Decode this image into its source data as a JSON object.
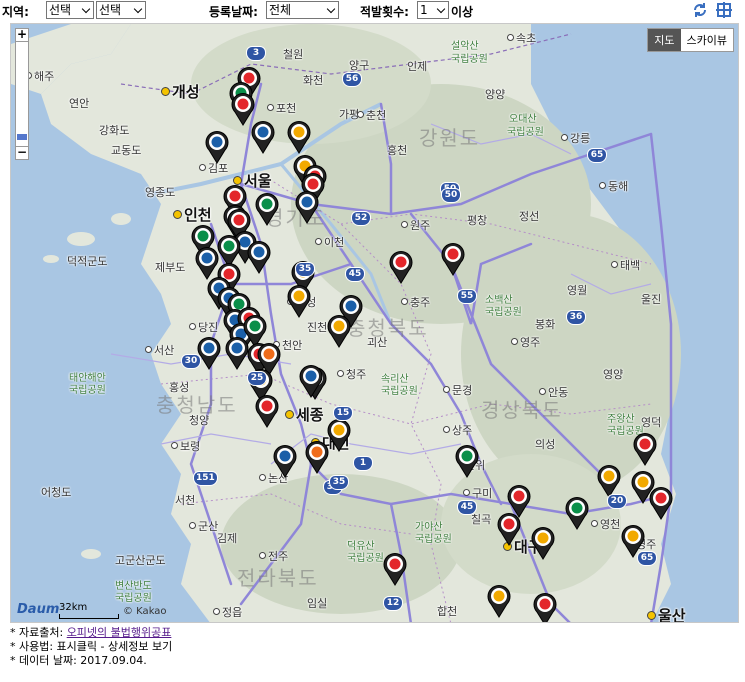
{
  "filters": {
    "region_label": "지역:",
    "region_value1": "선택",
    "region_value2": "선택",
    "date_label": "등록날짜:",
    "date_value": "전체",
    "count_label": "적발횟수:",
    "count_value": "1",
    "count_suffix": "이상",
    "refresh_icon": "refresh-icon",
    "fullscreen_icon": "crosshair-icon"
  },
  "map": {
    "type_buttons": [
      "지도",
      "스카이뷰"
    ],
    "zoom_in": "+",
    "zoom_out": "−",
    "logo": "Daum",
    "scale": "32km",
    "copyright": "© Kakao",
    "places": [
      {
        "name": "해주",
        "kind": "town"
      },
      {
        "name": "개성",
        "kind": "city"
      },
      {
        "name": "연안",
        "kind": "small"
      },
      {
        "name": "철원",
        "kind": "small"
      },
      {
        "name": "설악산",
        "kind": "park"
      },
      {
        "name": "국립공원",
        "kind": "park"
      },
      {
        "name": "속초",
        "kind": "town"
      },
      {
        "name": "양구",
        "kind": "small"
      },
      {
        "name": "화천",
        "kind": "small"
      },
      {
        "name": "인제",
        "kind": "small"
      },
      {
        "name": "양양",
        "kind": "small"
      },
      {
        "name": "포천",
        "kind": "town"
      },
      {
        "name": "가평",
        "kind": "small"
      },
      {
        "name": "춘천",
        "kind": "town"
      },
      {
        "name": "홍천",
        "kind": "small"
      },
      {
        "name": "오대산",
        "kind": "park"
      },
      {
        "name": "국립공원",
        "kind": "park"
      },
      {
        "name": "강원도",
        "kind": "prov"
      },
      {
        "name": "강릉",
        "kind": "town"
      },
      {
        "name": "강화도",
        "kind": "small"
      },
      {
        "name": "교동도",
        "kind": "small"
      },
      {
        "name": "김포",
        "kind": "town"
      },
      {
        "name": "서울",
        "kind": "city"
      },
      {
        "name": "영종도",
        "kind": "small"
      },
      {
        "name": "인천",
        "kind": "city"
      },
      {
        "name": "동해",
        "kind": "town"
      },
      {
        "name": "평창",
        "kind": "small"
      },
      {
        "name": "정선",
        "kind": "small"
      },
      {
        "name": "원주",
        "kind": "town"
      },
      {
        "name": "경기도",
        "kind": "prov"
      },
      {
        "name": "이천",
        "kind": "town"
      },
      {
        "name": "덕적군도",
        "kind": "small"
      },
      {
        "name": "제부도",
        "kind": "small"
      },
      {
        "name": "태백",
        "kind": "town"
      },
      {
        "name": "영월",
        "kind": "small"
      },
      {
        "name": "충주",
        "kind": "town"
      },
      {
        "name": "안성",
        "kind": "town"
      },
      {
        "name": "소백산",
        "kind": "park"
      },
      {
        "name": "국립공원",
        "kind": "park"
      },
      {
        "name": "울진",
        "kind": "small"
      },
      {
        "name": "당진",
        "kind": "town"
      },
      {
        "name": "진천",
        "kind": "small"
      },
      {
        "name": "충청북도",
        "kind": "prov"
      },
      {
        "name": "봉화",
        "kind": "small"
      },
      {
        "name": "서산",
        "kind": "town"
      },
      {
        "name": "괴산",
        "kind": "small"
      },
      {
        "name": "영주",
        "kind": "town"
      },
      {
        "name": "태안해안",
        "kind": "park"
      },
      {
        "name": "국립공원",
        "kind": "park"
      },
      {
        "name": "천안",
        "kind": "town"
      },
      {
        "name": "청주",
        "kind": "town"
      },
      {
        "name": "속리산",
        "kind": "park"
      },
      {
        "name": "국립공원",
        "kind": "park"
      },
      {
        "name": "문경",
        "kind": "town"
      },
      {
        "name": "안동",
        "kind": "town"
      },
      {
        "name": "영양",
        "kind": "small"
      },
      {
        "name": "홍성",
        "kind": "small"
      },
      {
        "name": "충청남도",
        "kind": "prov"
      },
      {
        "name": "세종",
        "kind": "city"
      },
      {
        "name": "경상북도",
        "kind": "prov"
      },
      {
        "name": "청양",
        "kind": "small"
      },
      {
        "name": "대전",
        "kind": "city"
      },
      {
        "name": "주왕산",
        "kind": "park"
      },
      {
        "name": "국립공원",
        "kind": "park"
      },
      {
        "name": "영덕",
        "kind": "small"
      },
      {
        "name": "상주",
        "kind": "town"
      },
      {
        "name": "보령",
        "kind": "town"
      },
      {
        "name": "의성",
        "kind": "small"
      },
      {
        "name": "논산",
        "kind": "town"
      },
      {
        "name": "군위",
        "kind": "small"
      },
      {
        "name": "어청도",
        "kind": "small"
      },
      {
        "name": "구미",
        "kind": "town"
      },
      {
        "name": "서천",
        "kind": "small"
      },
      {
        "name": "포항",
        "kind": "town"
      },
      {
        "name": "군산",
        "kind": "town"
      },
      {
        "name": "칠곡",
        "kind": "small"
      },
      {
        "name": "영천",
        "kind": "town"
      },
      {
        "name": "김제",
        "kind": "small"
      },
      {
        "name": "전주",
        "kind": "town"
      },
      {
        "name": "대구",
        "kind": "city"
      },
      {
        "name": "경주",
        "kind": "town"
      },
      {
        "name": "고군산군도",
        "kind": "small"
      },
      {
        "name": "가야산",
        "kind": "park"
      },
      {
        "name": "국립공원",
        "kind": "park"
      },
      {
        "name": "덕유산",
        "kind": "park"
      },
      {
        "name": "국립공원",
        "kind": "park"
      },
      {
        "name": "변산반도",
        "kind": "park"
      },
      {
        "name": "국립공원",
        "kind": "park"
      },
      {
        "name": "전라북도",
        "kind": "prov"
      },
      {
        "name": "정읍",
        "kind": "town"
      },
      {
        "name": "합천",
        "kind": "small"
      },
      {
        "name": "임실",
        "kind": "small"
      },
      {
        "name": "울산",
        "kind": "city"
      }
    ],
    "markers": [
      {
        "brand": "SK"
      },
      {
        "brand": "GS"
      },
      {
        "brand": "SK"
      },
      {
        "brand": "S-OIL"
      },
      {
        "brand": "HD"
      },
      {
        "brand": "HD"
      },
      {
        "brand": "S-OIL"
      },
      {
        "brand": "SK"
      },
      {
        "brand": "SK"
      },
      {
        "brand": "HD"
      },
      {
        "brand": "SK"
      },
      {
        "brand": "GS"
      },
      {
        "brand": "HD"
      },
      {
        "brand": "GS"
      },
      {
        "brand": "SK"
      },
      {
        "brand": "HD"
      },
      {
        "brand": "GS"
      },
      {
        "brand": "HD"
      },
      {
        "brand": "S-OIL"
      },
      {
        "brand": "SK"
      },
      {
        "brand": "SK"
      },
      {
        "brand": "HD"
      },
      {
        "brand": "SK"
      },
      {
        "brand": "HD"
      },
      {
        "brand": "S-OIL"
      },
      {
        "brand": "HD"
      },
      {
        "brand": "GS"
      },
      {
        "brand": "HD"
      },
      {
        "brand": "SK"
      },
      {
        "brand": "HD"
      },
      {
        "brand": "HD"
      },
      {
        "brand": "HD"
      },
      {
        "brand": "GS"
      },
      {
        "brand": "SK"
      },
      {
        "brand": "OIL"
      },
      {
        "brand": "HD"
      },
      {
        "brand": "S-OIL"
      },
      {
        "brand": "S-OIL"
      },
      {
        "brand": "HD"
      },
      {
        "brand": "S-OIL"
      },
      {
        "brand": "SK"
      },
      {
        "brand": "S-OIL"
      },
      {
        "brand": "HD"
      },
      {
        "brand": "OIL"
      },
      {
        "brand": "GS"
      },
      {
        "brand": "SK"
      },
      {
        "brand": "S-OIL"
      },
      {
        "brand": "S-OIL"
      },
      {
        "brand": "SK"
      },
      {
        "brand": "SK"
      },
      {
        "brand": "SK"
      },
      {
        "brand": "GS"
      },
      {
        "brand": "S-OIL"
      },
      {
        "brand": "S-OIL"
      },
      {
        "brand": "SK"
      },
      {
        "brand": "S-OIL"
      },
      {
        "brand": "SK"
      }
    ],
    "highways": [
      "3",
      "56",
      "65",
      "50",
      "52",
      "35",
      "45",
      "55",
      "36",
      "30",
      "25",
      "151",
      "35",
      "45",
      "20",
      "65",
      "12",
      "35",
      "1",
      "15",
      "50"
    ]
  },
  "notes": {
    "line1_prefix": "* 자료출처: ",
    "line1_link": "오피넷의 불법행위공표",
    "line2": "* 사용법: 표시클릭 - 상세정보 보기",
    "line3": "* 데이터 날짜: 2017.09.04."
  },
  "colors": {
    "sea": "#a9c6e3",
    "land": "#e3e7dc",
    "mountain": "#cdd6c3",
    "road_main": "#8f86d8",
    "marker": "#222222",
    "brand_sk": "#e3262b",
    "brand_gs": "#0a8f4a",
    "brand_hd": "#1b5fa8",
    "brand_soil": "#f2a900",
    "brand_oil": "#ef6c1a"
  }
}
